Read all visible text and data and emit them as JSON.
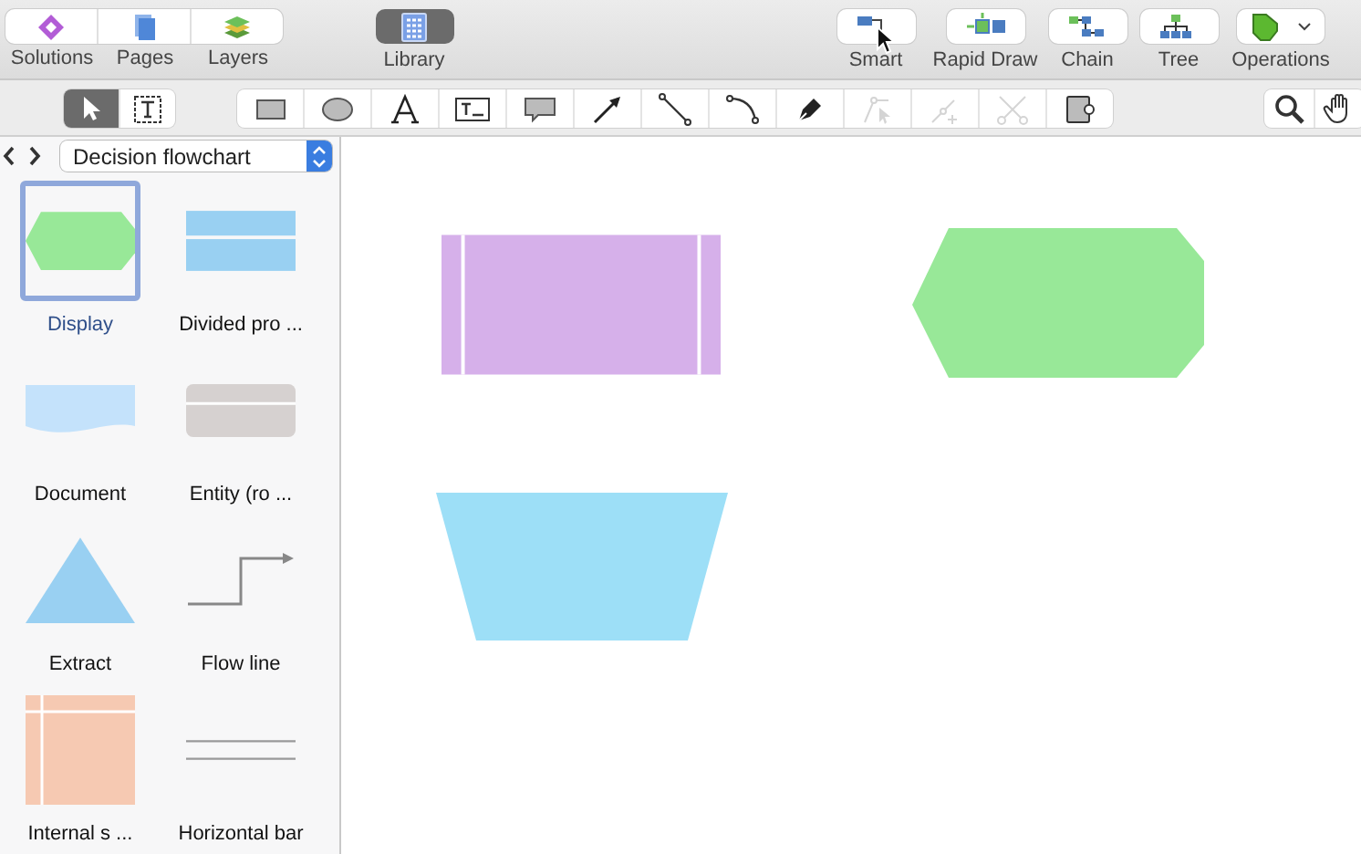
{
  "toolbar": {
    "left_buttons": [
      {
        "label": "Solutions",
        "kind": "solutions"
      },
      {
        "label": "Pages",
        "kind": "pages"
      },
      {
        "label": "Layers",
        "kind": "layers"
      }
    ],
    "library": {
      "label": "Library",
      "selected": true
    },
    "right_buttons": [
      {
        "label": "Smart",
        "kind": "smart"
      },
      {
        "label": "Rapid Draw",
        "kind": "rapid"
      },
      {
        "label": "Chain",
        "kind": "chain"
      },
      {
        "label": "Tree",
        "kind": "tree"
      },
      {
        "label": "Operations",
        "kind": "operations"
      }
    ]
  },
  "mode_tools": [
    {
      "kind": "pointer",
      "selected": true
    },
    {
      "kind": "text-box",
      "selected": false
    }
  ],
  "draw_tools": [
    {
      "kind": "rectangle",
      "disabled": false
    },
    {
      "kind": "ellipse",
      "disabled": false
    },
    {
      "kind": "text",
      "disabled": false
    },
    {
      "kind": "text-field",
      "disabled": false
    },
    {
      "kind": "callout",
      "disabled": false
    },
    {
      "kind": "arrow",
      "disabled": false
    },
    {
      "kind": "line",
      "disabled": false
    },
    {
      "kind": "curve",
      "disabled": false
    },
    {
      "kind": "pen",
      "disabled": false
    },
    {
      "kind": "edit-points",
      "disabled": true
    },
    {
      "kind": "add-point",
      "disabled": true
    },
    {
      "kind": "scissors",
      "disabled": true
    },
    {
      "kind": "connector",
      "disabled": false
    }
  ],
  "view_tools": [
    {
      "kind": "search"
    },
    {
      "kind": "hand"
    }
  ],
  "sidebar": {
    "library": "Decision flowchart",
    "items": [
      {
        "label": "Display",
        "kind": "display",
        "selected": true
      },
      {
        "label": "Divided pro ...",
        "kind": "divided",
        "selected": false
      },
      {
        "label": "Document",
        "kind": "document",
        "selected": false
      },
      {
        "label": "Entity (ro ...",
        "kind": "entity",
        "selected": false
      },
      {
        "label": "Extract",
        "kind": "extract",
        "selected": false
      },
      {
        "label": "Flow line",
        "kind": "flowline",
        "selected": false
      },
      {
        "label": "Internal s ...",
        "kind": "internal",
        "selected": false
      },
      {
        "label": "Horizontal bar",
        "kind": "hbar",
        "selected": false
      }
    ]
  },
  "canvas": {
    "shapes": [
      {
        "kind": "predefined-process"
      },
      {
        "kind": "display"
      },
      {
        "kind": "manual-operation"
      }
    ]
  }
}
